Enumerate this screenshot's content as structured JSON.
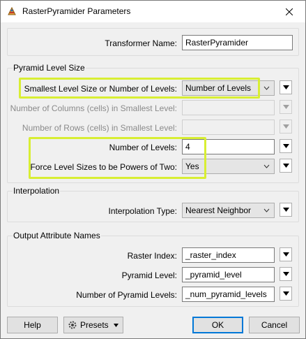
{
  "window": {
    "title": "RasterPyramider Parameters"
  },
  "transformer_name": {
    "label": "Transformer Name:",
    "value": "RasterPyramider"
  },
  "pyramid_level_size": {
    "title": "Pyramid Level Size",
    "smallest_level": {
      "label": "Smallest Level Size or Number of Levels:",
      "value": "Number of Levels"
    },
    "columns": {
      "label": "Number of Columns (cells) in Smallest Level:",
      "value": ""
    },
    "rows": {
      "label": "Number of Rows (cells) in Smallest Level:",
      "value": ""
    },
    "num_levels": {
      "label": "Number of Levels:",
      "value": "4"
    },
    "powers_of_two": {
      "label": "Force Level Sizes to be Powers of Two:",
      "value": "Yes"
    }
  },
  "interpolation": {
    "title": "Interpolation",
    "type": {
      "label": "Interpolation Type:",
      "value": "Nearest Neighbor"
    }
  },
  "output_attributes": {
    "title": "Output Attribute Names",
    "raster_index": {
      "label": "Raster Index:",
      "value": "_raster_index"
    },
    "pyramid_level": {
      "label": "Pyramid Level:",
      "value": "_pyramid_level"
    },
    "num_pyramid_levels": {
      "label": "Number of Pyramid Levels:",
      "value": "_num_pyramid_levels"
    }
  },
  "buttons": {
    "help": "Help",
    "presets": "Presets",
    "ok": "OK",
    "cancel": "Cancel"
  },
  "colors": {
    "highlight": "#d8ee33",
    "default_button_border": "#0078d7"
  },
  "icons": {
    "app": "fme-transformer-icon",
    "close": "close-icon",
    "presets": "gear-icon",
    "menu": "triangle-down-icon"
  }
}
